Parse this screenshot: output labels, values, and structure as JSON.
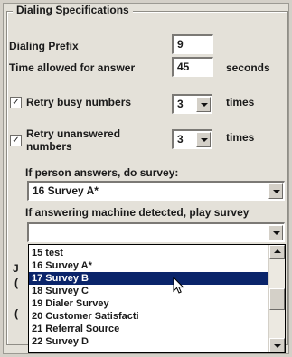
{
  "group": {
    "title": "Dialing Specifications"
  },
  "dialing_prefix": {
    "label": "Dialing Prefix",
    "value": "9"
  },
  "answer_time": {
    "label": "Time allowed for answer",
    "value": "45",
    "unit": "seconds"
  },
  "retry_busy": {
    "checked_glyph": "✓",
    "label": "Retry busy numbers",
    "value": "3",
    "unit": "times"
  },
  "retry_unanswered": {
    "checked_glyph": "✓",
    "label_line1": "Retry unanswered",
    "label_line2": "numbers",
    "value": "3",
    "unit": "times"
  },
  "person_answers": {
    "label": "If person answers, do survey:",
    "selected": "16 Survey A*"
  },
  "machine_detected": {
    "label": "If answering machine detected, play survey",
    "selected": "",
    "options": [
      "15 test",
      "16 Survey A*",
      "17 Survey B",
      "18 Survey C",
      "19 Dialer Survey",
      "20 Customer Satisfacti",
      "21 Referral Source",
      "22 Survey D"
    ],
    "highlighted_index": 2
  },
  "hidden_edge_letters": {
    "j": "J",
    "c1": "(",
    "c2": "("
  },
  "colors": {
    "selection": "#0a246a",
    "panel": "#e4e1d9"
  }
}
